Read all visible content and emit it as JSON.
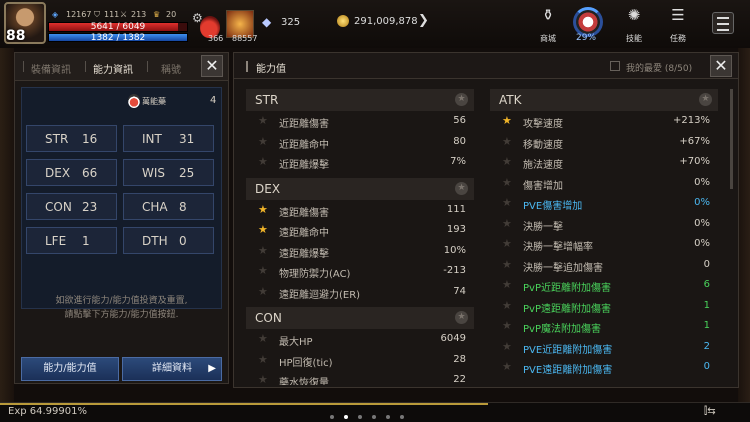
{
  "hud": {
    "level": "88",
    "power": "12167",
    "stat_a": "111",
    "stat_b": "213",
    "stat_c": "20",
    "hp": "5641 / 6049",
    "hp_fraction": 0.933,
    "mp": "1382 / 1382",
    "mp_fraction": 1.0,
    "potion_count": "366",
    "skill_count": "88557",
    "crystals": "325",
    "gold": "291,009,878",
    "menu": [
      {
        "icon": "shop-icon",
        "label": "商城"
      },
      {
        "icon": "percent-icon",
        "label": "29%"
      },
      {
        "icon": "skill-icon",
        "label": "技能"
      },
      {
        "icon": "quest-icon",
        "label": "任務"
      }
    ]
  },
  "left_panel": {
    "tabs": [
      "裝備資訊",
      "能力資訊",
      "稱號"
    ],
    "active_tab": 1,
    "flask_name": "萬能藥",
    "flask_count": "4",
    "stats": [
      {
        "name": "STR",
        "value": "16"
      },
      {
        "name": "INT",
        "value": "31"
      },
      {
        "name": "DEX",
        "value": "66"
      },
      {
        "name": "WIS",
        "value": "25"
      },
      {
        "name": "CON",
        "value": "23"
      },
      {
        "name": "CHA",
        "value": "8"
      },
      {
        "name": "LFE",
        "value": "1"
      },
      {
        "name": "DTH",
        "value": "0"
      }
    ],
    "hint_line1": "如欲進行能力/能力值投資及重置,",
    "hint_line2": "請點擊下方能力/能力值按鈕.",
    "btn_ability": "能力/能力值",
    "btn_detail": "詳細資料"
  },
  "right_panel": {
    "title": "能力值",
    "favorites": "我的最愛 (8/50)",
    "left_sections": [
      {
        "title": "STR",
        "rows": [
          {
            "label": "近距離傷害",
            "value": "56",
            "star": false
          },
          {
            "label": "近距離命中",
            "value": "80",
            "star": false
          },
          {
            "label": "近距離爆擊",
            "value": "7%",
            "star": false
          }
        ]
      },
      {
        "title": "DEX",
        "rows": [
          {
            "label": "遠距離傷害",
            "value": "111",
            "star": true
          },
          {
            "label": "遠距離命中",
            "value": "193",
            "star": true
          },
          {
            "label": "遠距離爆擊",
            "value": "10%",
            "star": false
          },
          {
            "label": "物理防禦力(AC)",
            "value": "-213",
            "star": false
          },
          {
            "label": "遠距離迴避力(ER)",
            "value": "74",
            "star": false
          }
        ]
      },
      {
        "title": "CON",
        "rows": [
          {
            "label": "最大HP",
            "value": "6049",
            "star": false
          },
          {
            "label": "HP回復(tic)",
            "value": "28",
            "star": false
          },
          {
            "label": "藥水恢復量",
            "value": "22",
            "star": false
          }
        ]
      }
    ],
    "right_sections": [
      {
        "title": "ATK",
        "rows": [
          {
            "label": "攻擊速度",
            "value": "+213%",
            "star": true,
            "color": ""
          },
          {
            "label": "移動速度",
            "value": "+67%",
            "star": false,
            "color": ""
          },
          {
            "label": "施法速度",
            "value": "+70%",
            "star": false,
            "color": ""
          },
          {
            "label": "傷害增加",
            "value": "0%",
            "star": false,
            "color": ""
          },
          {
            "label": "PVE傷害增加",
            "value": "0%",
            "star": false,
            "color": "blue"
          },
          {
            "label": "決勝一擊",
            "value": "0%",
            "star": false,
            "color": ""
          },
          {
            "label": "決勝一擊增幅率",
            "value": "0%",
            "star": false,
            "color": ""
          },
          {
            "label": "決勝一擊追加傷害",
            "value": "0",
            "star": false,
            "color": ""
          },
          {
            "label": "PvP近距離附加傷害",
            "value": "6",
            "star": false,
            "color": "green"
          },
          {
            "label": "PvP遠距離附加傷害",
            "value": "1",
            "star": false,
            "color": "green"
          },
          {
            "label": "PvP魔法附加傷害",
            "value": "1",
            "star": false,
            "color": "green"
          },
          {
            "label": "PVE近距離附加傷害",
            "value": "2",
            "star": false,
            "color": "blue"
          },
          {
            "label": "PVE遠距離附加傷害",
            "value": "0",
            "star": false,
            "color": "blue"
          }
        ]
      }
    ]
  },
  "bottom": {
    "exp": "Exp 64.99901%",
    "exp_fraction": 0.65
  }
}
